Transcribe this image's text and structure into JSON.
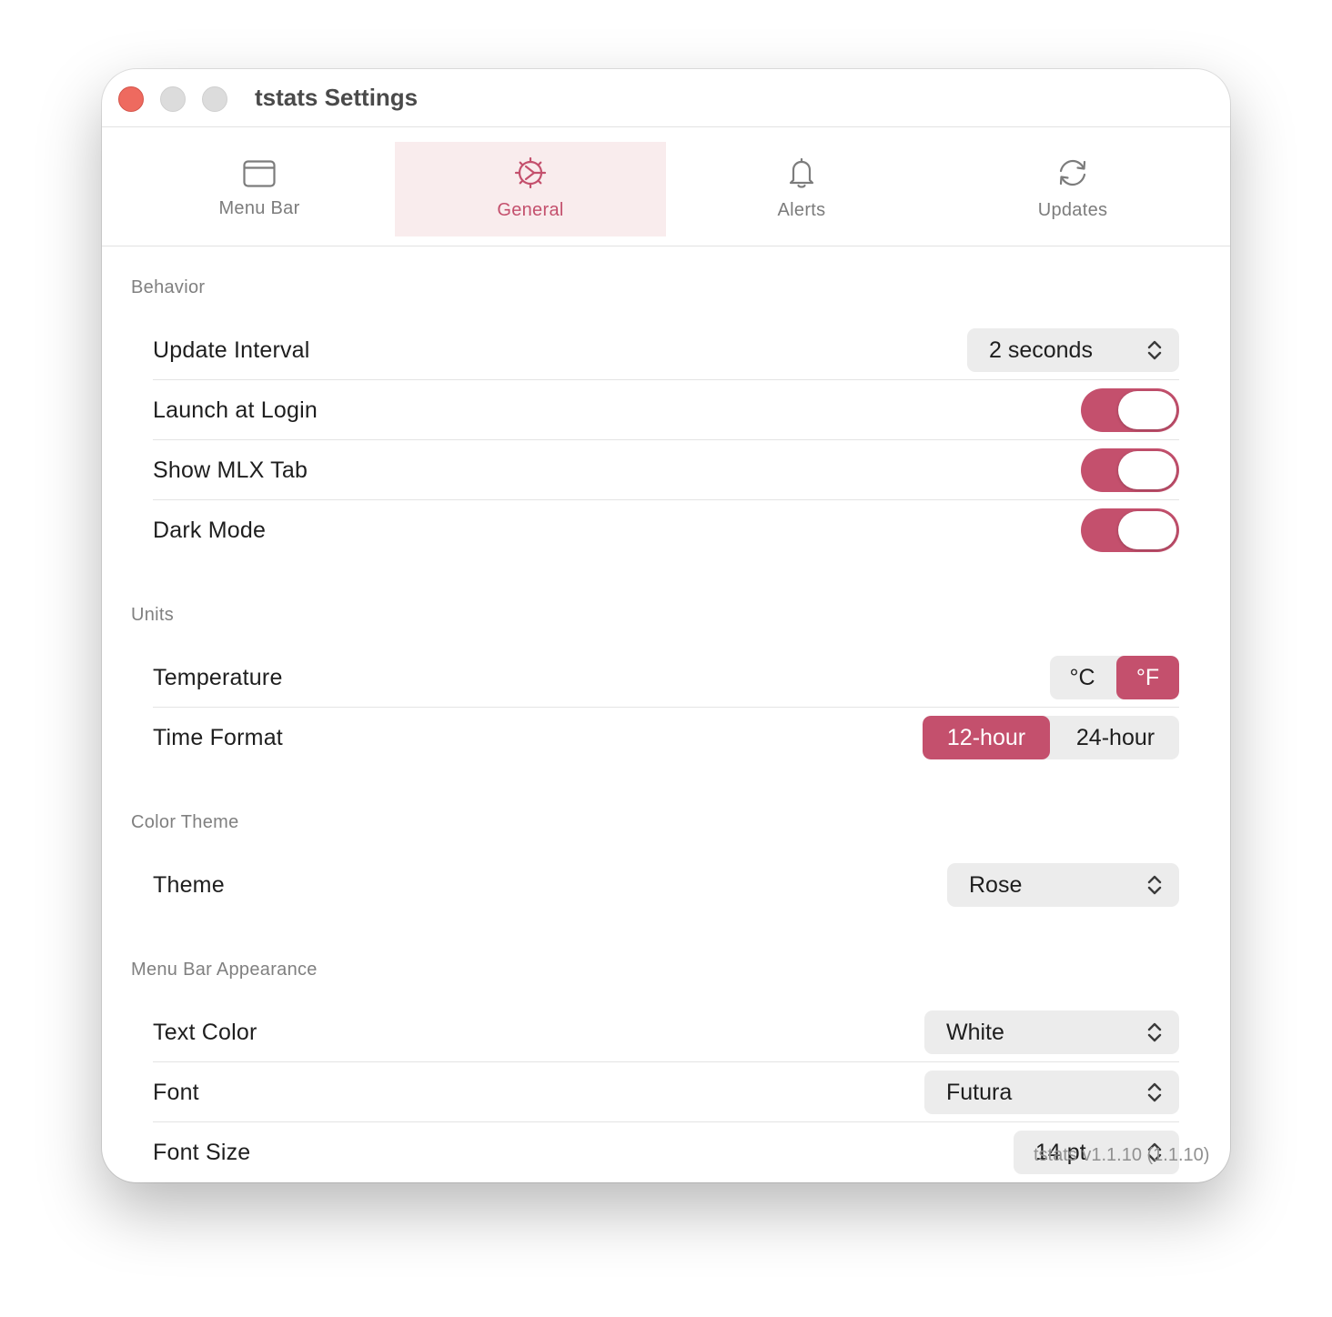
{
  "window": {
    "title": "tstats Settings"
  },
  "tabs": [
    {
      "label": "Menu Bar",
      "icon": "window-icon",
      "active": false
    },
    {
      "label": "General",
      "icon": "gear-icon",
      "active": true
    },
    {
      "label": "Alerts",
      "icon": "bell-icon",
      "active": false
    },
    {
      "label": "Updates",
      "icon": "refresh-icon",
      "active": false
    }
  ],
  "behavior": {
    "header": "Behavior",
    "update_interval": {
      "label": "Update Interval",
      "value": "2 seconds"
    },
    "launch_at_login": {
      "label": "Launch at Login",
      "on": true
    },
    "show_mlx_tab": {
      "label": "Show MLX Tab",
      "on": true
    },
    "dark_mode": {
      "label": "Dark Mode",
      "on": true
    }
  },
  "units": {
    "header": "Units",
    "temperature": {
      "label": "Temperature",
      "options": [
        "°C",
        "°F"
      ],
      "selected": "°F"
    },
    "time_format": {
      "label": "Time Format",
      "options": [
        "12-hour",
        "24-hour"
      ],
      "selected": "12-hour"
    }
  },
  "color_theme": {
    "header": "Color Theme",
    "theme": {
      "label": "Theme",
      "value": "Rose"
    }
  },
  "menu_bar_appearance": {
    "header": "Menu Bar Appearance",
    "text_color": {
      "label": "Text Color",
      "value": "White"
    },
    "font": {
      "label": "Font",
      "value": "Futura"
    },
    "font_size": {
      "label": "Font Size",
      "value": "14 pt"
    }
  },
  "footer": {
    "version": "tstats v1.1.10 (1.1.10)"
  },
  "colors": {
    "accent": "#c4506d",
    "accent_tint": "#f9eced",
    "control_bg": "#ececec"
  }
}
